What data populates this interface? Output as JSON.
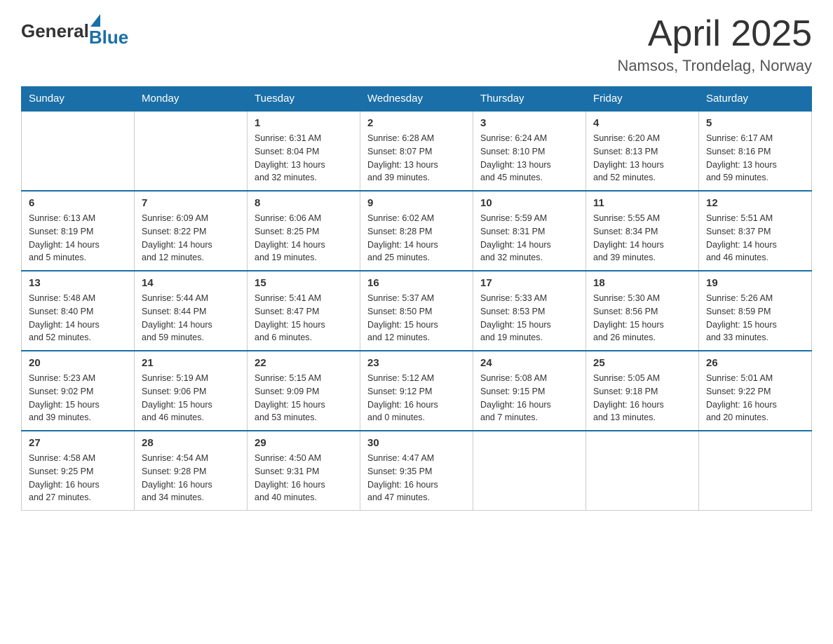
{
  "header": {
    "logo_general": "General",
    "logo_blue": "Blue",
    "month_title": "April 2025",
    "subtitle": "Namsos, Trondelag, Norway"
  },
  "weekdays": [
    "Sunday",
    "Monday",
    "Tuesday",
    "Wednesday",
    "Thursday",
    "Friday",
    "Saturday"
  ],
  "weeks": [
    [
      {
        "day": "",
        "info": ""
      },
      {
        "day": "",
        "info": ""
      },
      {
        "day": "1",
        "info": "Sunrise: 6:31 AM\nSunset: 8:04 PM\nDaylight: 13 hours\nand 32 minutes."
      },
      {
        "day": "2",
        "info": "Sunrise: 6:28 AM\nSunset: 8:07 PM\nDaylight: 13 hours\nand 39 minutes."
      },
      {
        "day": "3",
        "info": "Sunrise: 6:24 AM\nSunset: 8:10 PM\nDaylight: 13 hours\nand 45 minutes."
      },
      {
        "day": "4",
        "info": "Sunrise: 6:20 AM\nSunset: 8:13 PM\nDaylight: 13 hours\nand 52 minutes."
      },
      {
        "day": "5",
        "info": "Sunrise: 6:17 AM\nSunset: 8:16 PM\nDaylight: 13 hours\nand 59 minutes."
      }
    ],
    [
      {
        "day": "6",
        "info": "Sunrise: 6:13 AM\nSunset: 8:19 PM\nDaylight: 14 hours\nand 5 minutes."
      },
      {
        "day": "7",
        "info": "Sunrise: 6:09 AM\nSunset: 8:22 PM\nDaylight: 14 hours\nand 12 minutes."
      },
      {
        "day": "8",
        "info": "Sunrise: 6:06 AM\nSunset: 8:25 PM\nDaylight: 14 hours\nand 19 minutes."
      },
      {
        "day": "9",
        "info": "Sunrise: 6:02 AM\nSunset: 8:28 PM\nDaylight: 14 hours\nand 25 minutes."
      },
      {
        "day": "10",
        "info": "Sunrise: 5:59 AM\nSunset: 8:31 PM\nDaylight: 14 hours\nand 32 minutes."
      },
      {
        "day": "11",
        "info": "Sunrise: 5:55 AM\nSunset: 8:34 PM\nDaylight: 14 hours\nand 39 minutes."
      },
      {
        "day": "12",
        "info": "Sunrise: 5:51 AM\nSunset: 8:37 PM\nDaylight: 14 hours\nand 46 minutes."
      }
    ],
    [
      {
        "day": "13",
        "info": "Sunrise: 5:48 AM\nSunset: 8:40 PM\nDaylight: 14 hours\nand 52 minutes."
      },
      {
        "day": "14",
        "info": "Sunrise: 5:44 AM\nSunset: 8:44 PM\nDaylight: 14 hours\nand 59 minutes."
      },
      {
        "day": "15",
        "info": "Sunrise: 5:41 AM\nSunset: 8:47 PM\nDaylight: 15 hours\nand 6 minutes."
      },
      {
        "day": "16",
        "info": "Sunrise: 5:37 AM\nSunset: 8:50 PM\nDaylight: 15 hours\nand 12 minutes."
      },
      {
        "day": "17",
        "info": "Sunrise: 5:33 AM\nSunset: 8:53 PM\nDaylight: 15 hours\nand 19 minutes."
      },
      {
        "day": "18",
        "info": "Sunrise: 5:30 AM\nSunset: 8:56 PM\nDaylight: 15 hours\nand 26 minutes."
      },
      {
        "day": "19",
        "info": "Sunrise: 5:26 AM\nSunset: 8:59 PM\nDaylight: 15 hours\nand 33 minutes."
      }
    ],
    [
      {
        "day": "20",
        "info": "Sunrise: 5:23 AM\nSunset: 9:02 PM\nDaylight: 15 hours\nand 39 minutes."
      },
      {
        "day": "21",
        "info": "Sunrise: 5:19 AM\nSunset: 9:06 PM\nDaylight: 15 hours\nand 46 minutes."
      },
      {
        "day": "22",
        "info": "Sunrise: 5:15 AM\nSunset: 9:09 PM\nDaylight: 15 hours\nand 53 minutes."
      },
      {
        "day": "23",
        "info": "Sunrise: 5:12 AM\nSunset: 9:12 PM\nDaylight: 16 hours\nand 0 minutes."
      },
      {
        "day": "24",
        "info": "Sunrise: 5:08 AM\nSunset: 9:15 PM\nDaylight: 16 hours\nand 7 minutes."
      },
      {
        "day": "25",
        "info": "Sunrise: 5:05 AM\nSunset: 9:18 PM\nDaylight: 16 hours\nand 13 minutes."
      },
      {
        "day": "26",
        "info": "Sunrise: 5:01 AM\nSunset: 9:22 PM\nDaylight: 16 hours\nand 20 minutes."
      }
    ],
    [
      {
        "day": "27",
        "info": "Sunrise: 4:58 AM\nSunset: 9:25 PM\nDaylight: 16 hours\nand 27 minutes."
      },
      {
        "day": "28",
        "info": "Sunrise: 4:54 AM\nSunset: 9:28 PM\nDaylight: 16 hours\nand 34 minutes."
      },
      {
        "day": "29",
        "info": "Sunrise: 4:50 AM\nSunset: 9:31 PM\nDaylight: 16 hours\nand 40 minutes."
      },
      {
        "day": "30",
        "info": "Sunrise: 4:47 AM\nSunset: 9:35 PM\nDaylight: 16 hours\nand 47 minutes."
      },
      {
        "day": "",
        "info": ""
      },
      {
        "day": "",
        "info": ""
      },
      {
        "day": "",
        "info": ""
      }
    ]
  ]
}
